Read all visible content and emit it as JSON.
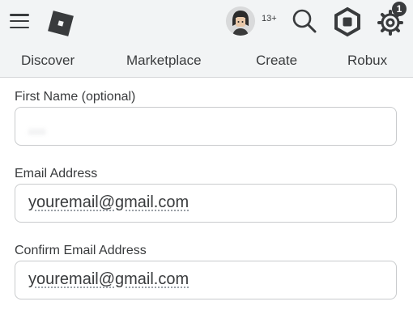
{
  "header": {
    "menu_icon": "hamburger-menu-icon",
    "logo_icon": "roblox-logo-icon",
    "age_badge": "13+",
    "search_icon": "search-icon",
    "robux_icon": "robux-icon",
    "settings_icon": "gear-icon",
    "notification_count": "1"
  },
  "nav": {
    "items": [
      {
        "label": "Discover"
      },
      {
        "label": "Marketplace"
      },
      {
        "label": "Create"
      },
      {
        "label": "Robux"
      }
    ]
  },
  "form": {
    "first_name": {
      "label": "First Name (optional)",
      "value": "......"
    },
    "email": {
      "label": "Email Address",
      "value": "youremail@gmail.com"
    },
    "confirm_email": {
      "label": "Confirm Email Address",
      "value": "youremail@gmail.com"
    }
  },
  "colors": {
    "bar_bg": "#f2f4f5",
    "text": "#393b3d",
    "border": "#c9cbcd"
  }
}
